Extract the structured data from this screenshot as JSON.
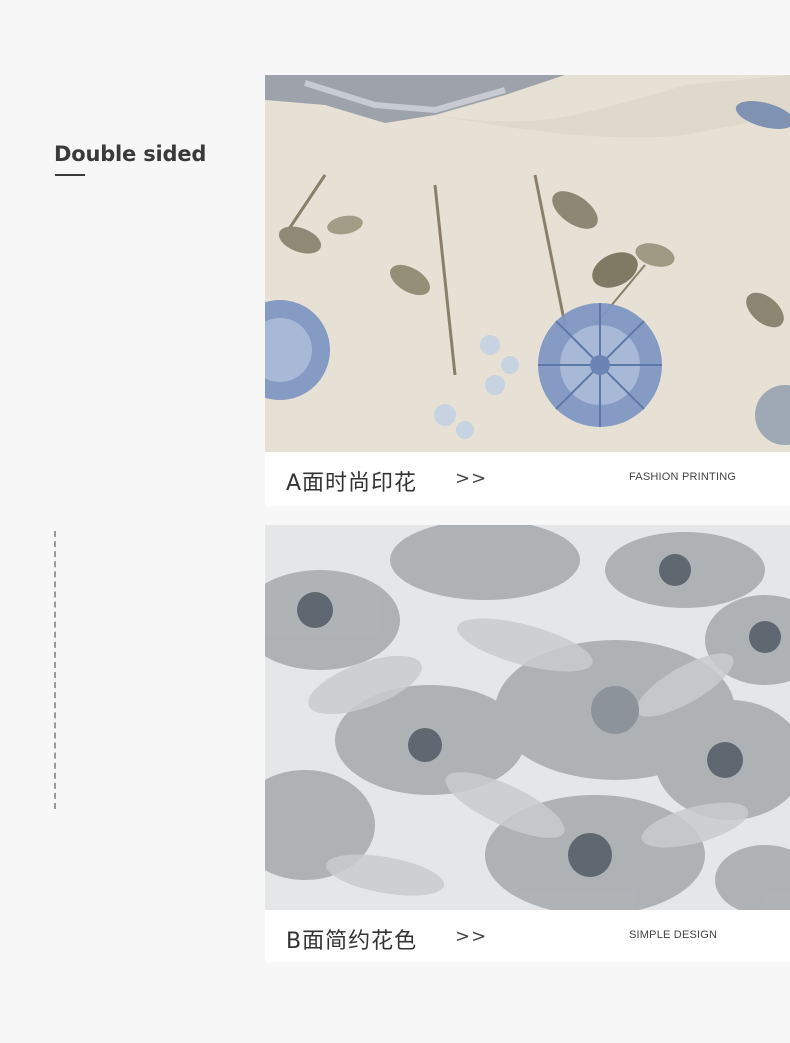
{
  "sidebar": {
    "title": "Double sided"
  },
  "panels": [
    {
      "caption_cn": "A面时尚印花",
      "arrow": ">>",
      "caption_en": "FASHION PRINTING",
      "pattern": "cream fabric with blue and grey flowers"
    },
    {
      "caption_cn": "B面简约花色",
      "arrow": ">>",
      "caption_en": "SIMPLE DESIGN",
      "pattern": "white fabric with grey daisy print"
    }
  ],
  "colors": {
    "background": "#f7f7f7",
    "card": "#ffffff",
    "text": "#333333",
    "fabric_a": "#e8e3d6",
    "fabric_b": "#dcdfe1"
  }
}
